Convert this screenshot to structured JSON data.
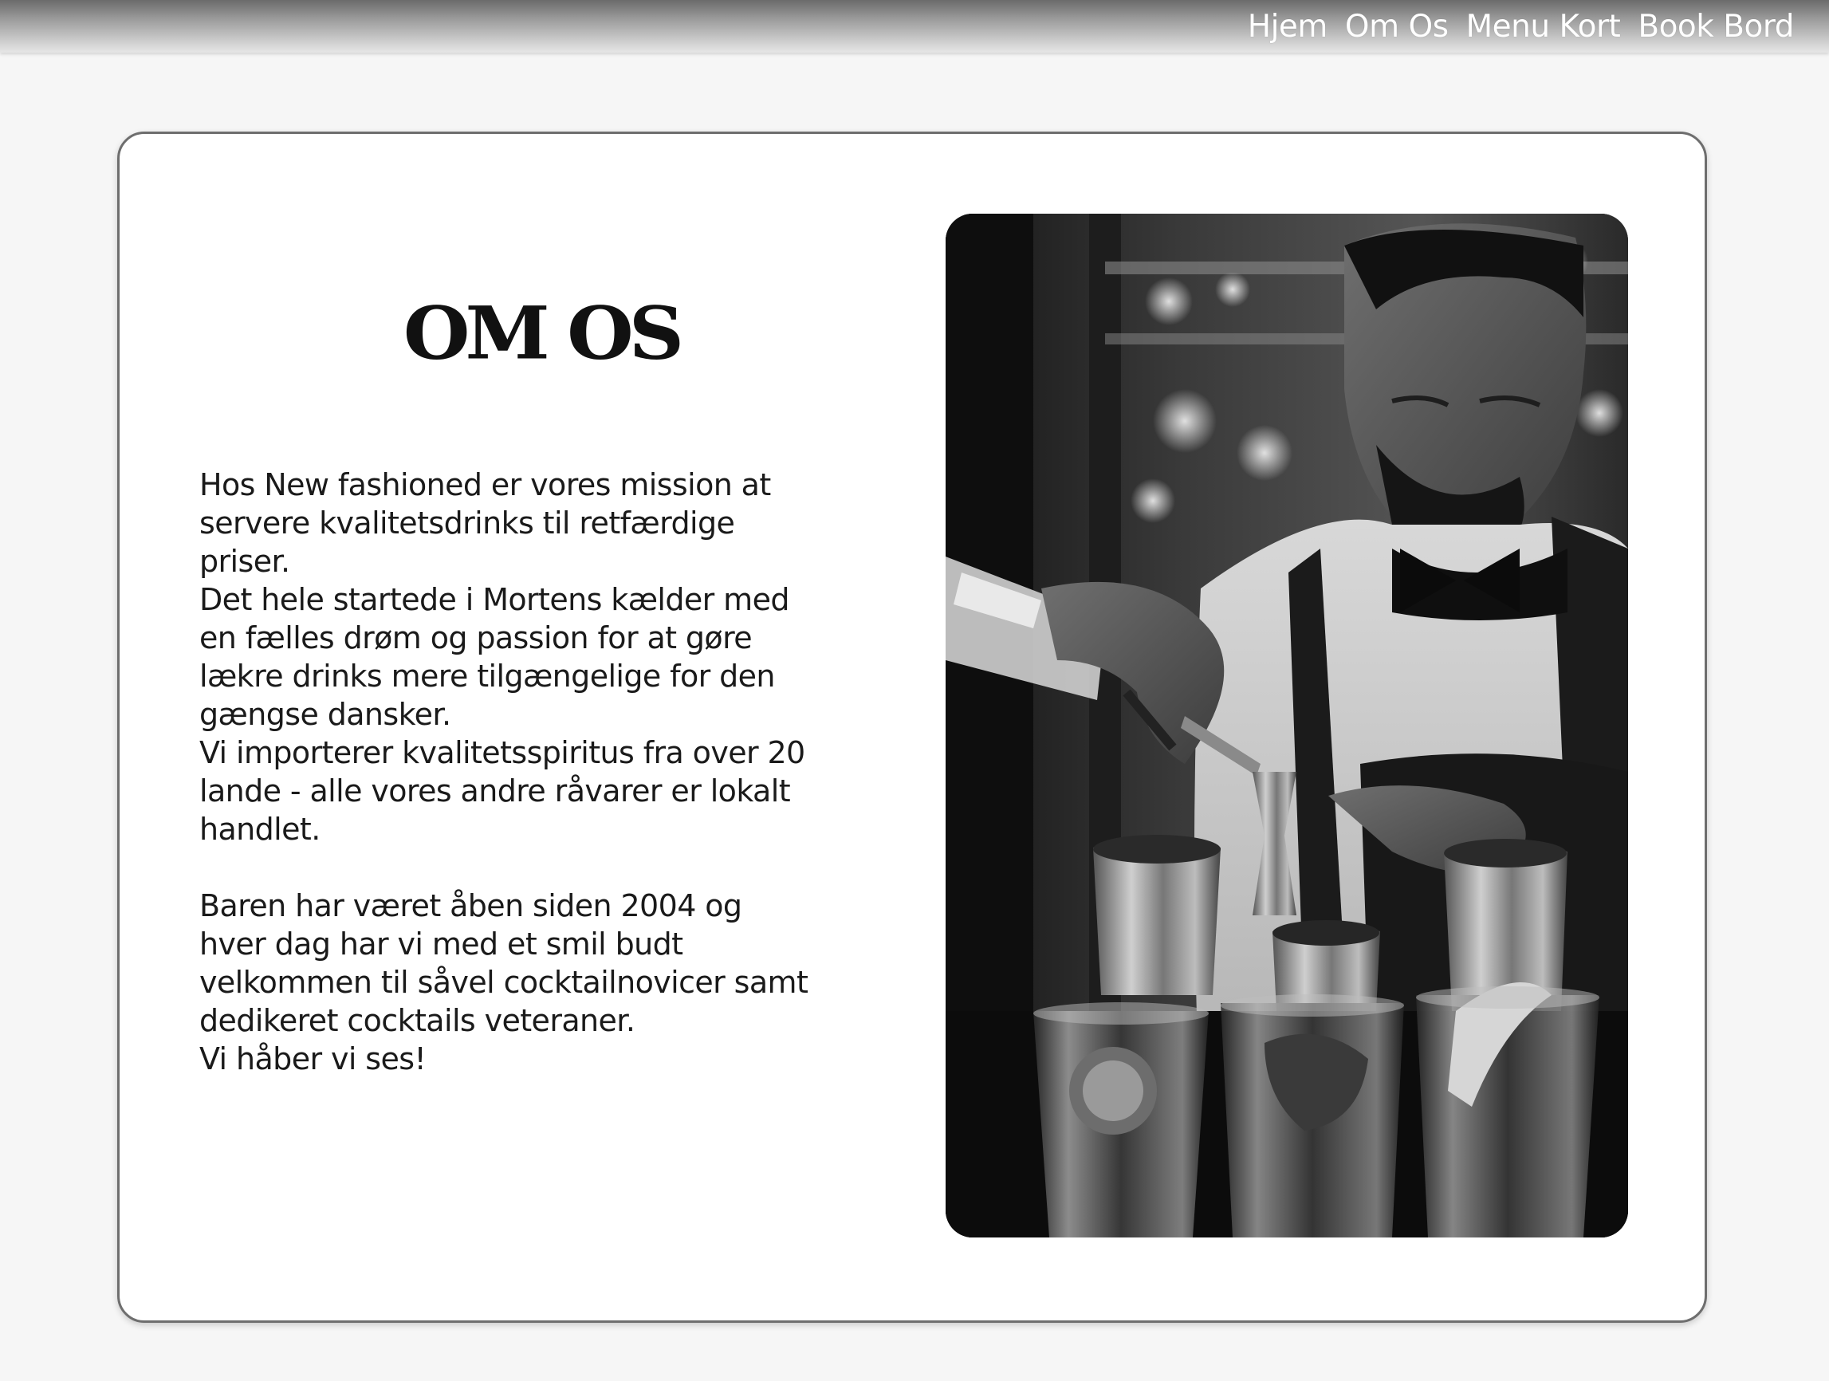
{
  "nav": {
    "items": [
      {
        "label": "Hjem"
      },
      {
        "label": "Om Os"
      },
      {
        "label": "Menu Kort"
      },
      {
        "label": "Book Bord"
      }
    ]
  },
  "about": {
    "title": "OM OS",
    "lines": [
      "Hos New fashioned er vores mission at",
      "servere kvalitetsdrinks til retfærdige",
      "priser.",
      "Det hele startede i Mortens kælder med",
      "en fælles drøm og passion for at gøre",
      "lækre drinks mere tilgængelige for den",
      "gængse dansker.",
      "Vi importerer kvalitetsspiritus fra over 20",
      "lande - alle vores andre råvarer er lokalt",
      "handlet.",
      "Baren har været åben siden 2004 og",
      "hver dag har vi med et smil budt",
      "velkommen til såvel cocktailnovicer samt",
      "dedikeret cocktails veteraner.",
      "Vi håber vi ses!"
    ]
  },
  "photo": {
    "subject": "bartender-pouring-cocktail-photo",
    "tone": "black-and-white"
  },
  "colors": {
    "page_background": "#f6f6f6",
    "card_background": "#ffffff",
    "card_border": "#6e6e6e",
    "nav_text": "#ffffff",
    "body_text": "#1a1a1a"
  }
}
